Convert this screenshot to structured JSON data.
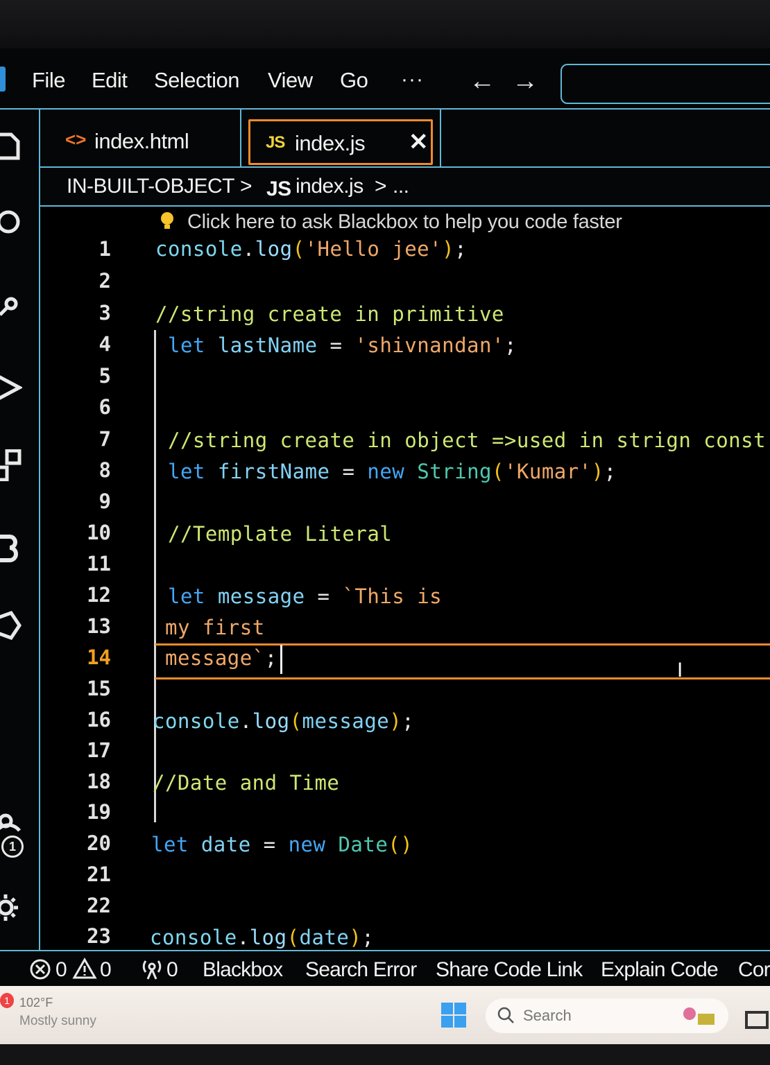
{
  "menu": {
    "items": [
      {
        "label": "File"
      },
      {
        "label": "Edit"
      },
      {
        "label": "Selection"
      },
      {
        "label": "View"
      },
      {
        "label": "Go"
      }
    ],
    "more": "···",
    "back": "←",
    "forward": "→"
  },
  "tabs": [
    {
      "label": "index.html",
      "icon": "html-icon",
      "icon_text": "<>"
    },
    {
      "label": "index.js",
      "icon": "js-icon",
      "icon_text": "JS",
      "active": true,
      "close": "✕"
    }
  ],
  "breadcrumb": {
    "folder": "IN-BUILT-OBJECT",
    "sep1": ">",
    "file_icon": "JS",
    "file": "index.js",
    "sep2": ">",
    "more": "..."
  },
  "editor": {
    "hint": "Click here to ask Blackbox to help you code faster",
    "active_line": 14,
    "line_numbers": [
      "1",
      "2",
      "3",
      "4",
      "5",
      "6",
      "7",
      "8",
      "9",
      "10",
      "11",
      "12",
      "13",
      "14",
      "15",
      "16",
      "17",
      "18",
      "19",
      "20",
      "21",
      "22",
      "23"
    ],
    "lines": {
      "l1": [
        "console",
        ".",
        "log",
        "(",
        "'Hello jee'",
        ")",
        ";"
      ],
      "l3": "//string create in primitive",
      "l4": [
        "let",
        " lastName",
        " = ",
        "'shivnandan'",
        ";"
      ],
      "l7": "//string create in object =>used in strign const",
      "l8": [
        "let",
        " firstName",
        " = ",
        "new",
        " String",
        "(",
        "'Kumar'",
        ")",
        ";"
      ],
      "l10": "//Template Literal",
      "l12": [
        "let",
        " message",
        " = ",
        "`This is"
      ],
      "l13": "my first",
      "l14": [
        "message`",
        ";"
      ],
      "l16": [
        "console",
        ".",
        "log",
        "(",
        "message",
        ")",
        ";"
      ],
      "l18": "//Date and Time",
      "l20": [
        "let",
        " date",
        " = ",
        "new",
        " Date",
        "()"
      ],
      "l23": [
        "console",
        ".",
        "log",
        "(",
        "date",
        ")",
        ";"
      ]
    },
    "mouse_cursor": "I"
  },
  "status": {
    "errors": "0",
    "warnings": "0",
    "ports": "0",
    "items": [
      {
        "label": "Blackbox"
      },
      {
        "label": "Search Error"
      },
      {
        "label": "Share Code Link"
      },
      {
        "label": "Explain Code"
      },
      {
        "label": "Cor"
      }
    ]
  },
  "activity": {
    "badge": "1"
  },
  "taskbar": {
    "weather_badge": "1",
    "temperature": "102°F",
    "condition": "Mostly sunny",
    "search_placeholder": "Search"
  },
  "colors": {
    "accent": "#5fb8d8",
    "active_tab_border": "#f08a2a",
    "comment": "#cde874",
    "string": "#f0a868",
    "keyword": "#43a6f5",
    "bracket": "#f3c21d"
  }
}
